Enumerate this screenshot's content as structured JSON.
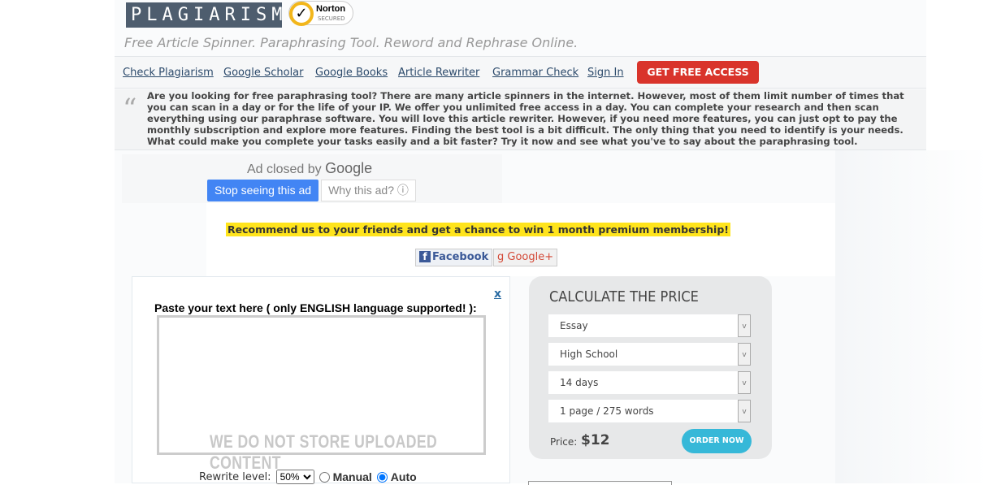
{
  "header": {
    "logo": "PLAGIARISMA",
    "norton_title": "Norton",
    "norton_sub": "SECURED",
    "tagline": "Free Article Spinner. Paraphrasing Tool. Reword and Rephrase Online."
  },
  "nav": {
    "items": [
      "Check Plagiarism",
      "Google Scholar",
      "Google Books",
      "Article Rewriter",
      "Grammar Check",
      "Sign In"
    ],
    "cta": "GET FREE ACCESS"
  },
  "intro": "Are you looking for free paraphrasing tool? There are many article spinners in the internet. However, most of them limit number of times that you can scan in a day or for the life of your IP. We offer you unlimited free access in a day. You can complete your research and then scan everything using our paraphrase software. You will love this article rewriter. However, if you need more features, you can just opt to pay the monthly subscription and explore more features. Finding the best tool is a bit difficult. The only thing that you need to identify is your needs. What could make you complete your tasks easily and a bit faster? Try it now and see what you've to say about the paraphrasing tool.",
  "ad": {
    "closed_by": "Ad closed by",
    "google": "Google",
    "stop": "Stop seeing this ad",
    "why": "Why this ad? ⓘ"
  },
  "promo": "Recommend us to your friends and get a chance to win 1 month premium membership!",
  "social": {
    "facebook": "Facebook",
    "google": "Google+"
  },
  "editor": {
    "close": "x",
    "label": "Paste your text here ( only ENGLISH language supported! ):",
    "value": "",
    "watermark": "WE DO NOT STORE UPLOADED CONTENT",
    "rewrite_label": "Rewrite level:",
    "rewrite_value": "50%",
    "mode_manual": "Manual",
    "mode_auto": "Auto",
    "selected_mode": "Auto"
  },
  "price": {
    "title": "CALCULATE THE PRICE",
    "selects": [
      "Essay",
      "High School",
      "14 days",
      "1 page / 275 words"
    ],
    "price_label": "Price:",
    "price_value": "$12",
    "order": "ORDER NOW"
  },
  "colors": {
    "cta": "#d9342b",
    "order": "#36b8d8",
    "promo_bg": "#ffe41c",
    "ad_blue": "#4285f4"
  }
}
